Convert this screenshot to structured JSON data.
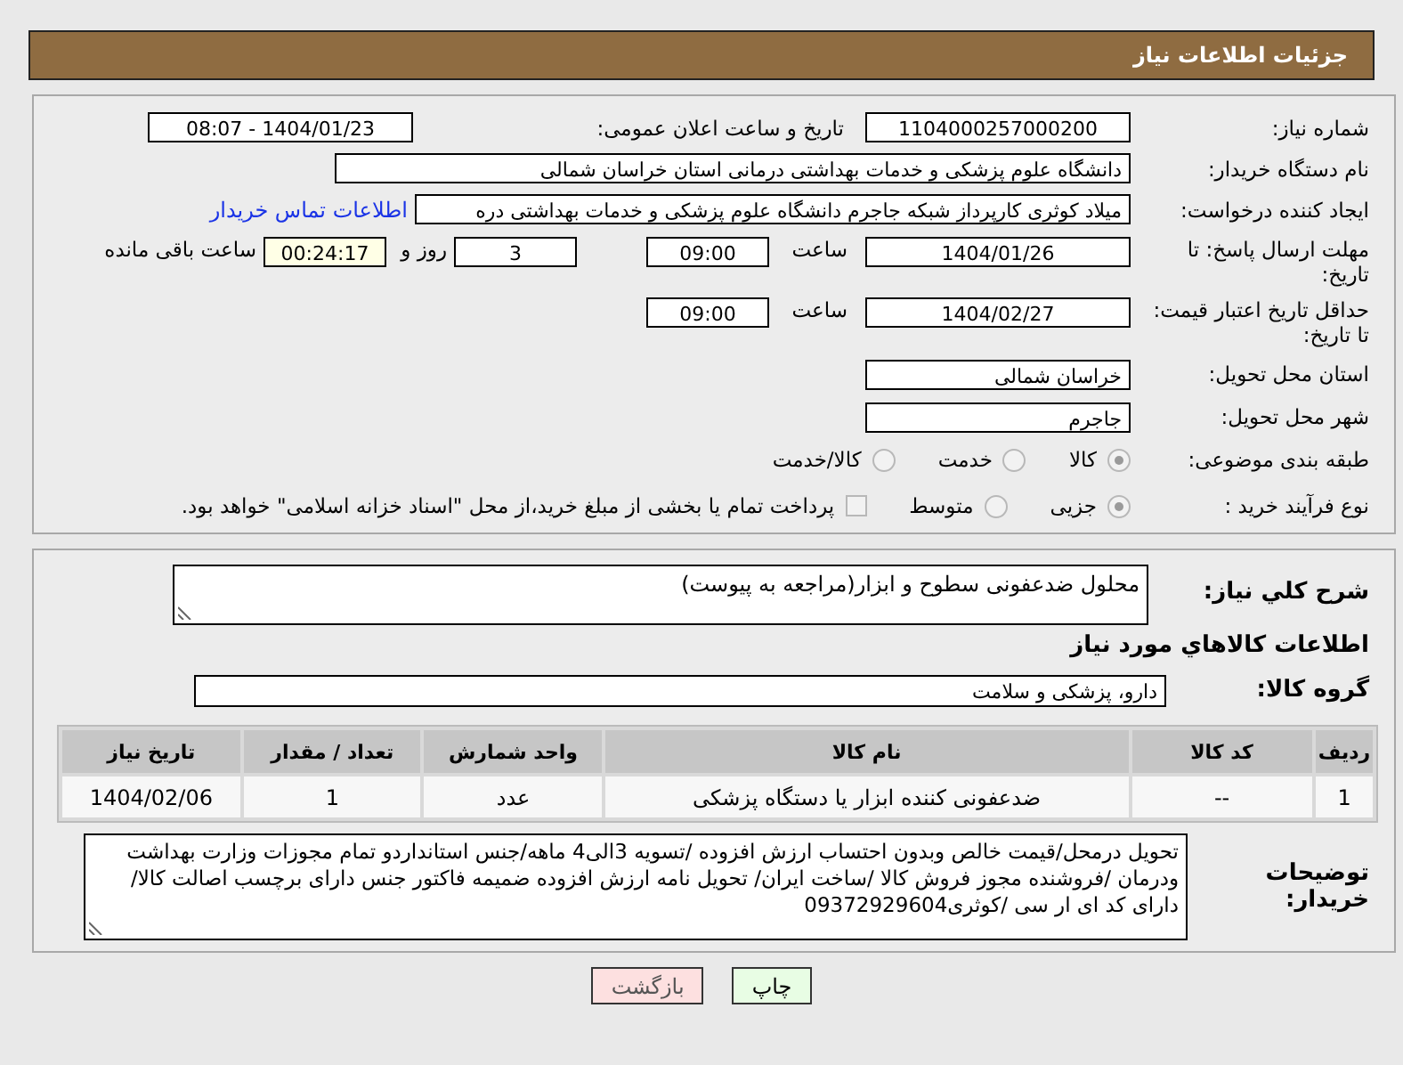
{
  "header": {
    "title": "جزئیات اطلاعات نیاز"
  },
  "need_number": {
    "label": "شماره نیاز:",
    "value": "1104000257000200"
  },
  "announce": {
    "label": "تاریخ و ساعت اعلان عمومی:",
    "value": "1404/01/23 - 08:07"
  },
  "buyer_org": {
    "label": "نام دستگاه خریدار:",
    "value": "دانشگاه علوم پزشکی و خدمات بهداشتی درمانی استان خراسان شمالی"
  },
  "requester": {
    "label": "ایجاد کننده درخواست:",
    "value": "میلاد کوثری کارپرداز شبکه جاجرم دانشگاه علوم پزشکی و خدمات بهداشتی دره",
    "link": "اطلاعات تماس خریدار"
  },
  "response_deadline": {
    "label": "مهلت ارسال پاسخ: تا تاریخ:",
    "date": "1404/01/26",
    "time_label": "ساعت",
    "time": "09:00",
    "days": "3",
    "days_label": "روز و",
    "remaining": "00:24:17",
    "remaining_label": "ساعت باقی مانده"
  },
  "price_validity": {
    "label": "حداقل تاریخ اعتبار قیمت: تا تاریخ:",
    "date": "1404/02/27",
    "time_label": "ساعت",
    "time": "09:00"
  },
  "province": {
    "label": "استان محل تحویل:",
    "value": "خراسان شمالی"
  },
  "city": {
    "label": "شهر محل تحویل:",
    "value": "جاجرم"
  },
  "category": {
    "label": "طبقه بندی موضوعی:",
    "options": [
      {
        "label": "كالا",
        "selected": true
      },
      {
        "label": "خدمت",
        "selected": false
      },
      {
        "label": "كالا/خدمت",
        "selected": false
      }
    ]
  },
  "purchase_type": {
    "label": "نوع فرآیند خرید :",
    "options": [
      {
        "kind": "radio",
        "label": "جزیی",
        "selected": true
      },
      {
        "kind": "radio",
        "label": "متوسط",
        "selected": false
      },
      {
        "kind": "checkbox",
        "label": "پرداخت تمام یا بخشی از مبلغ خرید،از محل \"اسناد خزانه اسلامی\" خواهد بود.",
        "checked": false
      }
    ]
  },
  "summary": {
    "label": "شرح كلي نياز:",
    "value": "محلول ضدعفونی سطوح و ابزار(مراجعه به پیوست)"
  },
  "goods_heading": "اطلاعات كالاهاي مورد نياز",
  "goods_group": {
    "label": "گروه كالا:",
    "value": "دارو، پزشکی و سلامت"
  },
  "table": {
    "columns": [
      "ردیف",
      "كد كالا",
      "نام كالا",
      "واحد شمارش",
      "تعداد / مقدار",
      "تاریخ نیاز"
    ],
    "rows": [
      [
        "1",
        "--",
        "ضدعفونی کننده ابزار یا دستگاه پزشکی",
        "عدد",
        "1",
        "1404/02/06"
      ]
    ]
  },
  "buyer_notes": {
    "label": "توضیحات خریدار:",
    "value": "تحویل درمحل/قیمت خالص وبدون احتساب ارزش افزوده /تسویه 3الی4 ماهه/جنس استانداردو تمام مجوزات وزارت بهداشت ودرمان /فروشنده مجوز فروش کالا /ساخت ایران/ تحویل  نامه ارزش افزوده ضمیمه  فاکتور جنس دارای برچسب اصالت کالا/ دارای کد ای ار سی /کوثری09372929604"
  },
  "buttons": [
    {
      "kind": "print",
      "label": "چاپ"
    },
    {
      "kind": "back",
      "label": "بازگشت"
    }
  ]
}
